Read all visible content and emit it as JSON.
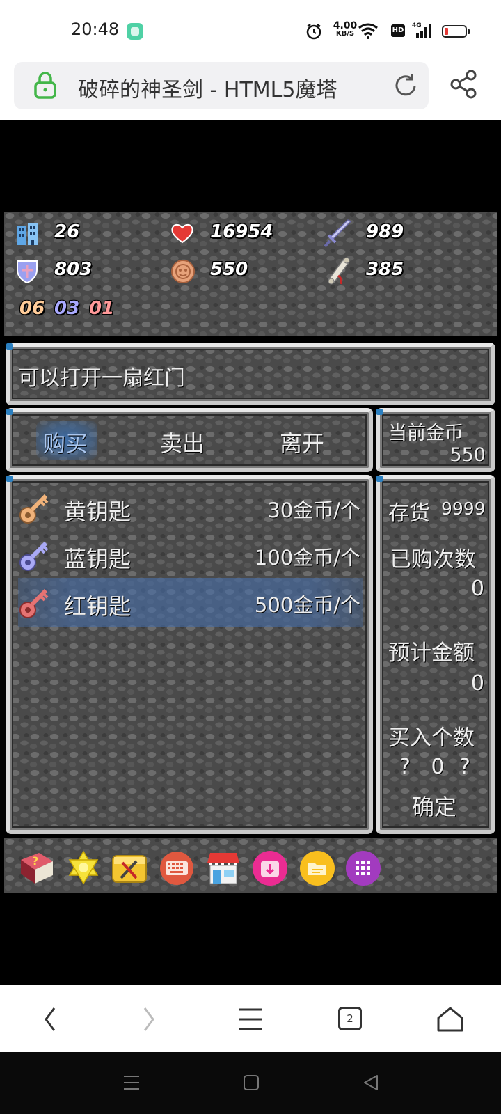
{
  "status_bar": {
    "time": "20:48",
    "net_speed_value": "4.00",
    "net_speed_unit": "KB/S",
    "hd_label": "HD",
    "network_label": "4G"
  },
  "browser": {
    "page_title": "破碎的神圣剑 - HTML5魔塔"
  },
  "hud": {
    "floor": "26",
    "hp": "16954",
    "atk": "989",
    "def": "803",
    "gold": "550",
    "exp": "385",
    "keys": {
      "yellow": "06",
      "blue": "03",
      "red": "01"
    },
    "colors": {
      "yellow_key": "#ffcc99",
      "blue_key": "#aaaaff",
      "red_key": "#ff9999"
    }
  },
  "message": "可以打开一扇红门",
  "shop": {
    "tabs": [
      "购买",
      "卖出",
      "离开"
    ],
    "selected_tab": 0,
    "current_gold_label": "当前金币",
    "current_gold_value": "550",
    "items": [
      {
        "name": "黄钥匙",
        "price": "30金币/个",
        "icon": "yellow-key-icon",
        "color": "#f0b27a"
      },
      {
        "name": "蓝钥匙",
        "price": "100金币/个",
        "icon": "blue-key-icon",
        "color": "#a9a9f5"
      },
      {
        "name": "红钥匙",
        "price": "500金币/个",
        "icon": "red-key-icon",
        "color": "#e57373"
      }
    ],
    "selected_item": 2,
    "stock_label": "存货",
    "stock_value": "9999",
    "bought_label": "已购次数",
    "bought_value": "0",
    "estimate_label": "预计金额",
    "estimate_value": "0",
    "qty_label": "买入个数",
    "qty_dec": "?",
    "qty_value": "0",
    "qty_inc": "?",
    "confirm_label": "确定"
  },
  "toolbar": {
    "icons": [
      "monster-book-icon",
      "fly-star-icon",
      "toolbox-icon",
      "keyboard-icon",
      "shop-icon",
      "save-icon",
      "load-icon",
      "menu-grid-icon"
    ]
  },
  "browser_nav": {
    "tab_count": "2"
  }
}
